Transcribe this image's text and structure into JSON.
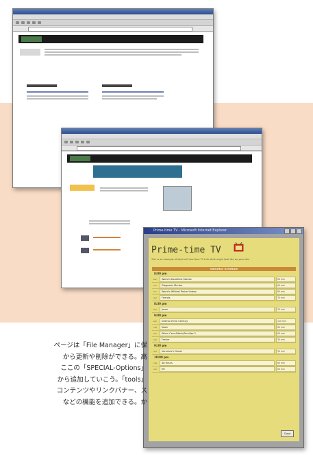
{
  "window_primetime": {
    "title": "Prime-time TV - Microsoft Internet Explorer",
    "heading": "Prime-time TV",
    "intro": "This is an example of what a Prime-time TV Info Vault might look like on your site.",
    "schedule_header": "Saturday Schedule",
    "days": [
      {
        "day": "8:00 pm",
        "rows": [
          {
            "tag": "abc",
            "name": "World's Deadliest Stories",
            "duration": "60 min"
          },
          {
            "tag": "fox",
            "name": "Diagnosis Murder",
            "duration": "60 min"
          },
          {
            "tag": "fox",
            "name": "World's Wildest Police Videos",
            "duration": "60 min"
          },
          {
            "tag": "nbc",
            "name": "Friends",
            "duration": "30 min"
          }
        ]
      },
      {
        "day": "8:30 pm",
        "rows": [
          {
            "tag": "nbc",
            "name": "Jesse",
            "duration": "30 min"
          }
        ]
      },
      {
        "day": "9:00 pm",
        "rows": [
          {
            "tag": "abc",
            "name": "Drama of the Century",
            "duration": "120 min"
          },
          {
            "tag": "cbs",
            "name": "Nash",
            "duration": "60 min"
          },
          {
            "tag": "fox",
            "name": "When Cars Attack/Families 2",
            "duration": "60 min"
          },
          {
            "tag": "nbc",
            "name": "Frasier",
            "duration": "30 min"
          }
        ]
      },
      {
        "day": "9:30 pm",
        "rows": [
          {
            "tag": "nbc",
            "name": "Veronica's Closet",
            "duration": "30 min"
          }
        ]
      },
      {
        "day": "10:00 pm",
        "rows": [
          {
            "tag": "cbs",
            "name": "48 Hours",
            "duration": "60 min"
          },
          {
            "tag": "nbc",
            "name": "ER",
            "duration": "60 min"
          }
        ]
      }
    ],
    "button": "Close"
  },
  "caption": {
    "lines": [
      "ページは「File Manager」に保",
      "から更新や削除ができる。高",
      "ここの「SPECIAL-Options」",
      "から追加していこう。「tools」",
      "コンテンツやリンクバナー、ス",
      "などの機能を追加できる。か"
    ]
  },
  "colors": {
    "peach": "#f9dcc6",
    "primetime_bg": "#e7dc7b",
    "schedule_header": "#c98a38"
  }
}
